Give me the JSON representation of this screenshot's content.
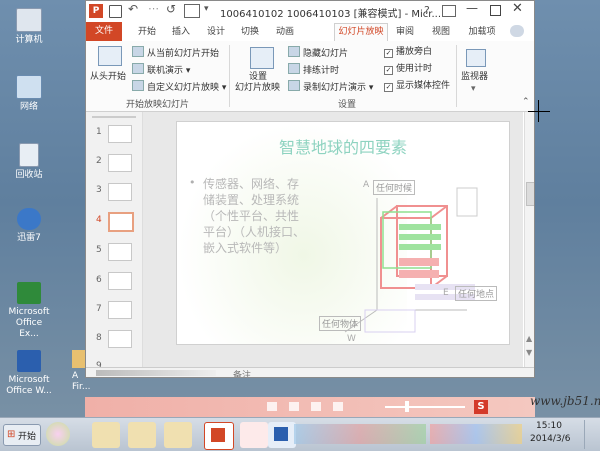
{
  "desktop": {
    "icons": [
      {
        "label": "计算机"
      },
      {
        "label": "网络"
      },
      {
        "label": "回收站"
      },
      {
        "label": "迅雷7"
      },
      {
        "label": "Microsoft Office Ex..."
      },
      {
        "label": "Microsoft Office W..."
      },
      {
        "label": "A Fir..."
      }
    ]
  },
  "window": {
    "title": "1006410102 1006410103 [兼容模式] - Micr...",
    "app_icon": "P"
  },
  "tabs": {
    "file": "文件",
    "items": [
      "开始",
      "插入",
      "设计",
      "切换",
      "动画",
      "幻灯片放映",
      "审阅",
      "视图",
      "加载项"
    ],
    "active": "幻灯片放映"
  },
  "ribbon": {
    "from_start": "从头开始",
    "from_current": "从当前幻灯片开始",
    "online": "联机演示",
    "custom": "自定义幻灯片放映",
    "group1": "开始放映幻灯片",
    "setup": "设置\n幻灯片放映",
    "setup_line1": "设置",
    "setup_line2": "幻灯片放映",
    "hide": "隐藏幻灯片",
    "rehearse": "排练计时",
    "record": "录制幻灯片演示",
    "play_narration": "播放旁白",
    "use_timings": "使用计时",
    "show_media": "显示媒体控件",
    "group2": "设置",
    "monitor": "监视器"
  },
  "thumbs": {
    "numbers": [
      "1",
      "2",
      "3",
      "4",
      "5",
      "6",
      "7",
      "8",
      "9"
    ],
    "selected": "4"
  },
  "slide": {
    "title": "智慧地球的四要素",
    "bullet": "传感器、网络、存储装置、处理系统（个性平台、共性平台）（人机接口、嵌入式软件等）",
    "bullet_lines": [
      "传感器、网络、存",
      "储装置、处理系统",
      "（个性平台、共性",
      "平台）（人机接口、",
      "嵌入式软件等）"
    ],
    "diagram_labels": {
      "a": "A",
      "any_time": "任何时候",
      "e": "E",
      "any_place": "任何地点",
      "w": "W",
      "any_thing": "任何物体"
    }
  },
  "notes": {
    "label": "备注"
  },
  "tray": {
    "time": "15:10",
    "date": "2014/3/6",
    "watermark": "www.jb51.net",
    "ime": "S"
  },
  "taskbar": {
    "start": "开始"
  }
}
